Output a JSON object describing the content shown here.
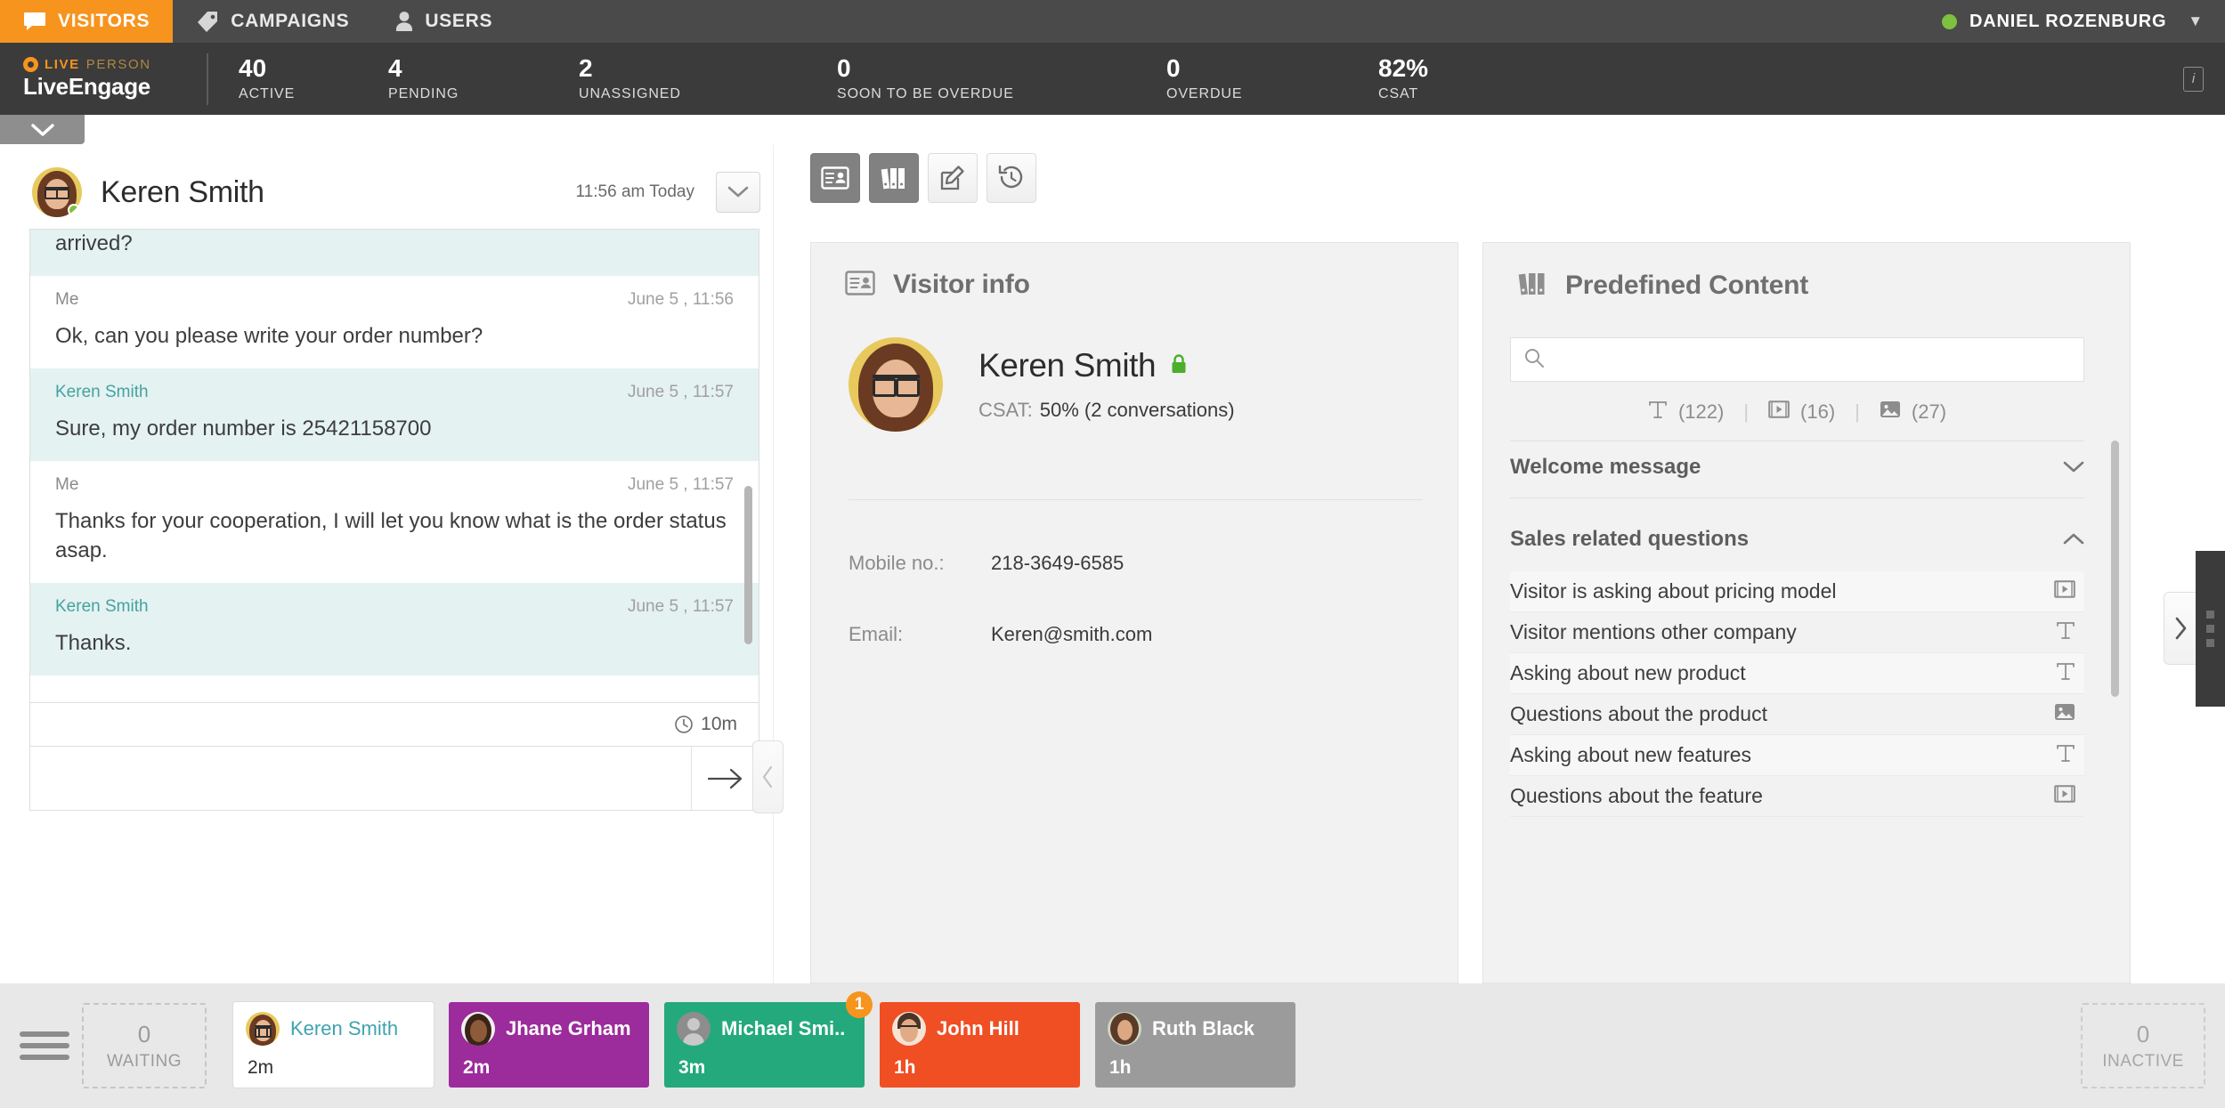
{
  "topnav": {
    "tabs": [
      {
        "label": "VISITORS",
        "icon": "chat-bubble-icon",
        "active": true
      },
      {
        "label": "CAMPAIGNS",
        "icon": "tag-icon",
        "active": false
      },
      {
        "label": "USERS",
        "icon": "person-icon",
        "active": false
      }
    ],
    "agent_name": "DANIEL ROZENBURG",
    "status_color": "#7dc13f"
  },
  "brand": {
    "live": "LIVE",
    "person": "PERSON",
    "engage": "LiveEngage"
  },
  "kpis": [
    {
      "value": "40",
      "label": "ACTIVE"
    },
    {
      "value": "4",
      "label": "PENDING"
    },
    {
      "value": "2",
      "label": "UNASSIGNED"
    },
    {
      "value": "0",
      "label": "SOON TO BE OVERDUE"
    },
    {
      "value": "0",
      "label": "OVERDUE"
    },
    {
      "value": "82%",
      "label": "CSAT"
    }
  ],
  "info_button_label": "i",
  "chat": {
    "visitor_name": "Keren Smith",
    "timestamp": "11:56 am  Today",
    "messages": [
      {
        "author": "",
        "stamp": "",
        "text": "arrived?",
        "side": "visitor",
        "partial": true
      },
      {
        "author": "Me",
        "stamp": "June 5 , 11:56",
        "text": "Ok, can you please write your order number?",
        "side": "agent",
        "partial": false
      },
      {
        "author": "Keren Smith",
        "stamp": "June 5 , 11:57",
        "text": "Sure, my order number is 25421158700",
        "side": "visitor",
        "partial": false
      },
      {
        "author": "Me",
        "stamp": "June 5 , 11:57",
        "text": "Thanks for your cooperation, I will let you know what is the order status asap.",
        "side": "agent",
        "partial": false
      },
      {
        "author": "Keren Smith",
        "stamp": "June 5 , 11:57",
        "text": "Thanks.",
        "side": "visitor",
        "partial": false
      }
    ],
    "duration": "10m",
    "composer_placeholder": "",
    "composer_value": ""
  },
  "toolbar": [
    {
      "icon": "visitor-info-icon",
      "active": true
    },
    {
      "icon": "predefined-content-icon",
      "active": true
    },
    {
      "icon": "edit-note-icon",
      "active": false
    },
    {
      "icon": "history-icon",
      "active": false
    }
  ],
  "visitor_info": {
    "title": "Visitor info",
    "name": "Keren Smith",
    "secure_icon": "green-lock-icon",
    "csat_label": "CSAT:",
    "csat_value": "50% (2 conversations)",
    "fields": [
      {
        "key": "Mobile no.:",
        "value": "218-3649-6585"
      },
      {
        "key": "Email:",
        "value": "Keren@smith.com"
      }
    ]
  },
  "predefined_content": {
    "title": "Predefined Content",
    "search_value": "",
    "search_placeholder": "",
    "counts": [
      {
        "icon": "text-icon",
        "value": "(122)"
      },
      {
        "icon": "video-icon",
        "value": "(16)"
      },
      {
        "icon": "image-icon",
        "value": "(27)"
      }
    ],
    "groups": [
      {
        "label": "Welcome message",
        "expanded": false,
        "chevron": "chevron-down-icon",
        "items": []
      },
      {
        "label": "Sales related questions",
        "expanded": true,
        "chevron": "chevron-up-icon",
        "items": [
          {
            "label": "Visitor is asking about pricing model",
            "icon": "video-icon"
          },
          {
            "label": "Visitor mentions other company",
            "icon": "text-icon"
          },
          {
            "label": "Asking about new product",
            "icon": "text-icon"
          },
          {
            "label": "Questions about the product",
            "icon": "image-icon"
          },
          {
            "label": "Asking about new features",
            "icon": "text-icon"
          },
          {
            "label": "Questions about the feature",
            "icon": "video-icon"
          }
        ]
      }
    ]
  },
  "bottombar": {
    "waiting": {
      "count": "0",
      "label": "WAITING"
    },
    "inactive": {
      "count": "0",
      "label": "INACTIVE"
    },
    "chips": [
      {
        "name": "Keren Smith",
        "time": "2m",
        "color": "#ffffff",
        "selected": true,
        "badge": null,
        "avatar": "female-glasses"
      },
      {
        "name": "Jhane Grham",
        "time": "2m",
        "color": "#9c2b9c",
        "selected": false,
        "badge": null,
        "avatar": "female-dark"
      },
      {
        "name": "Michael Smi..",
        "time": "3m",
        "color": "#23a97c",
        "selected": false,
        "badge": "1",
        "avatar": "placeholder"
      },
      {
        "name": "John Hill",
        "time": "1h",
        "color": "#f04e23",
        "selected": false,
        "badge": null,
        "avatar": "male-glasses"
      },
      {
        "name": "Ruth Black",
        "time": "1h",
        "color": "#9b9b9b",
        "selected": false,
        "badge": null,
        "avatar": "female-curly"
      }
    ]
  }
}
